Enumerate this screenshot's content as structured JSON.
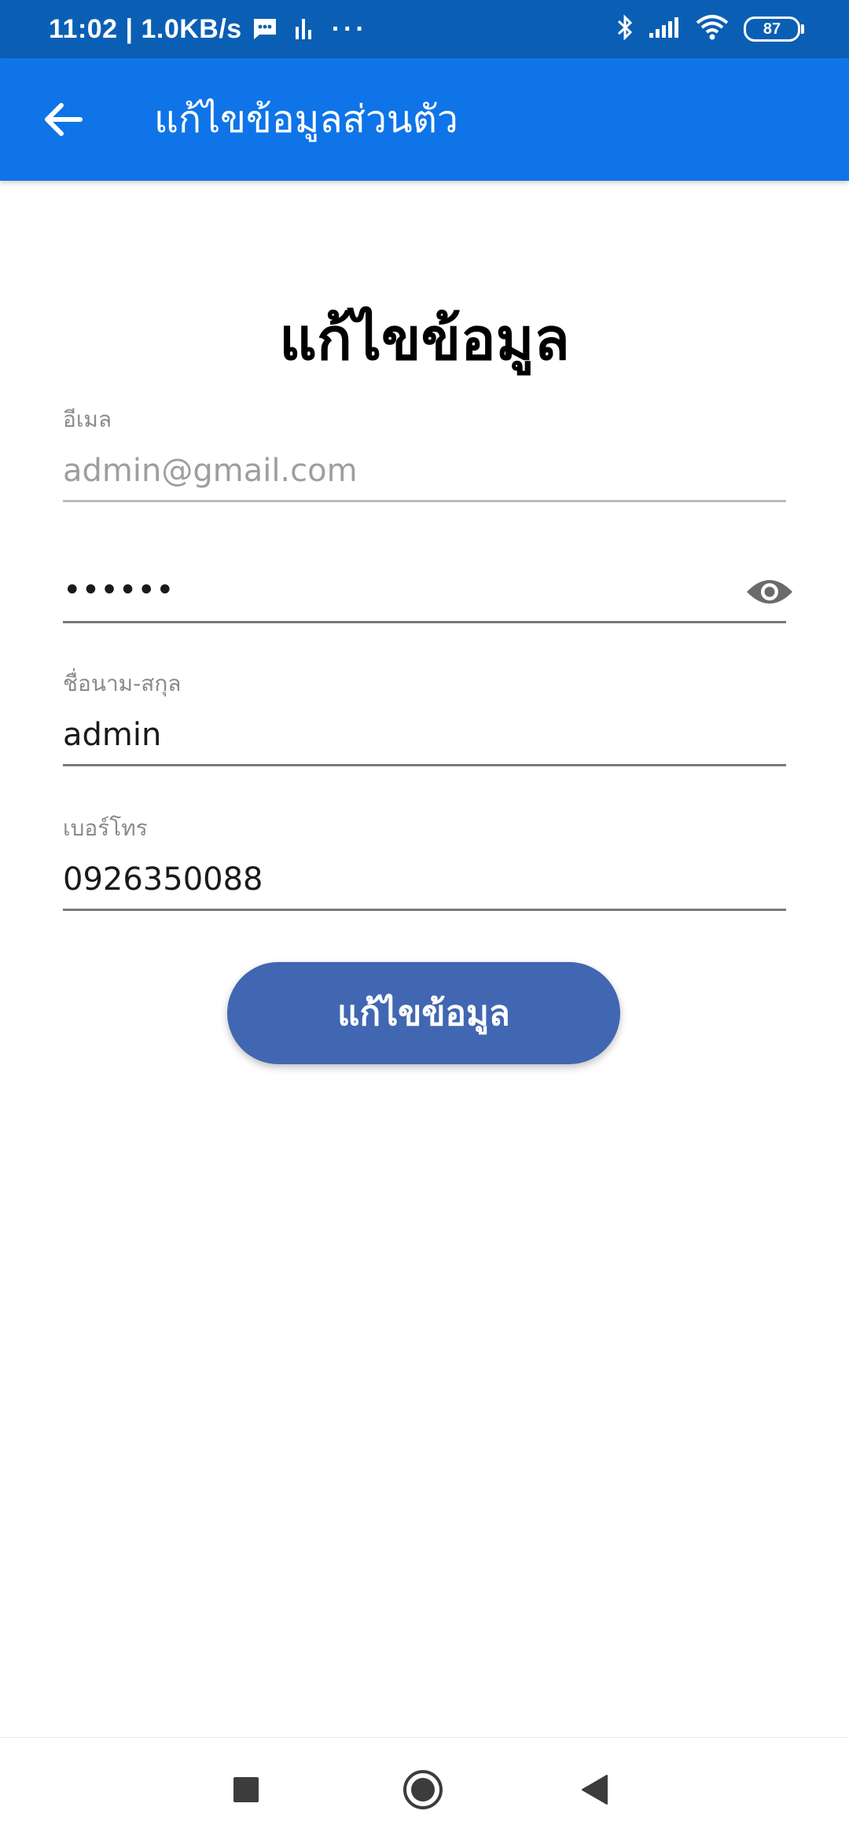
{
  "status_bar": {
    "time_speed": "11:02 | 1.0KB/s",
    "more": "···",
    "battery": "87"
  },
  "app_bar": {
    "title": "แก้ไขข้อมูลส่วนตัว"
  },
  "form": {
    "heading": "แก้ไขข้อมูล",
    "email": {
      "label": "อีเมล",
      "value": "admin@gmail.com"
    },
    "password": {
      "value": "••••••"
    },
    "fullname": {
      "label": "ชื่อนาม-สกุล",
      "value": "admin"
    },
    "phone": {
      "label": "เบอร์โทร",
      "value": "0926350088"
    },
    "submit_label": "แก้ไขข้อมูล"
  },
  "colors": {
    "status_bar": "#0a5fb4",
    "app_bar": "#0e74e8",
    "button": "#4167b2"
  },
  "icons": [
    "back-arrow-icon",
    "message-icon",
    "equalizer-icon",
    "bluetooth-icon",
    "signal-icon",
    "wifi-icon",
    "eye-icon",
    "square-icon",
    "circle-icon",
    "triangle-icon"
  ]
}
